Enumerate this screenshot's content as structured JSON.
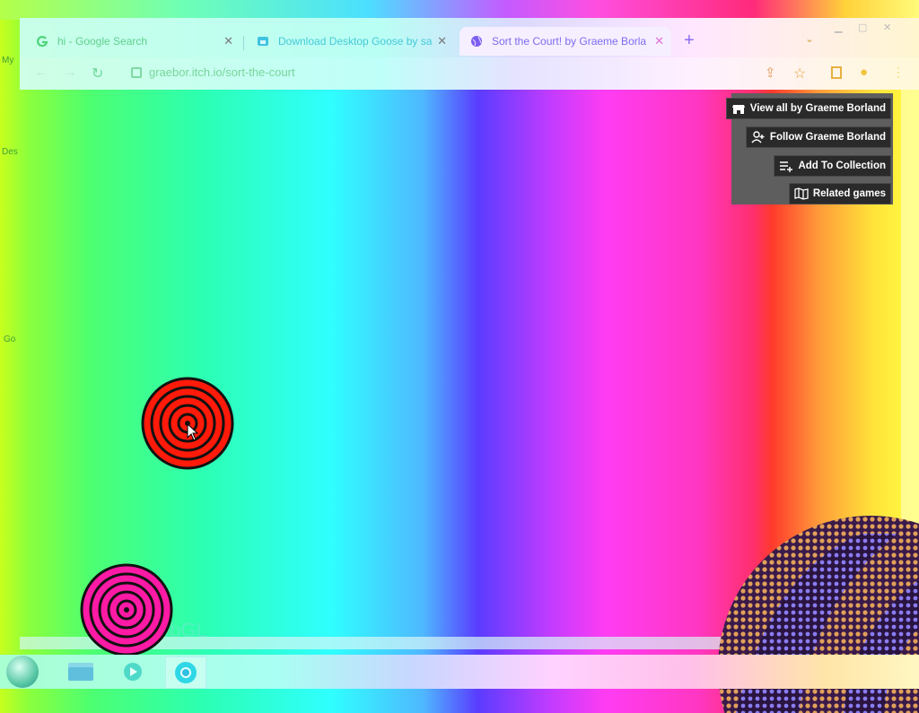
{
  "desktop": {
    "labels": [
      "My",
      "Des",
      "Go"
    ]
  },
  "browser": {
    "tabs": [
      {
        "title": "hi - Google Search",
        "close": "✕"
      },
      {
        "title": "Download Desktop Goose by sa",
        "close": "✕"
      },
      {
        "title": "Sort the Court! by Graeme Borla",
        "close": "✕"
      }
    ],
    "new_tab": "+",
    "tab_search": "⌄",
    "url": "graebor.itch.io/sort-the-court"
  },
  "itch_overlay": {
    "view_all": "View all by Graeme Borland",
    "follow": "Follow Graeme Borland",
    "add_collection": "Add To Collection",
    "related": "Related games"
  },
  "content": {
    "watermark": "ebGL"
  },
  "colors": {
    "target_red": "#ff1a0a",
    "target_pink": "#ff1aa5",
    "panel_bg": "#5e5e5e",
    "button_bg": "#2a2a2a"
  }
}
